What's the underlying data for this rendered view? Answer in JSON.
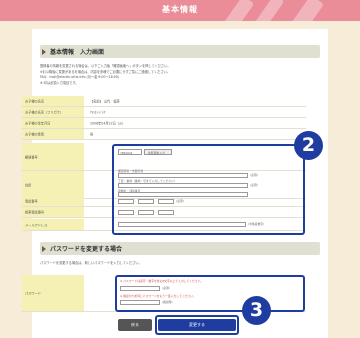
{
  "header": {
    "title": "基本情報"
  },
  "section_basic": {
    "title": "基本情報　入力画面"
  },
  "intro_lines": [
    "登録者の情報を変更される場合は、以下ご入力後「確認画面へ」ボタンを押してください。",
    "※お以降後に変更があるを場合は、内容を多様でご必要にせずご覧にご連絡してください。",
    "FAQ：mail@electtu.bfuk.info (月〜金 9:00〜18:00)",
    "※ 印は必須入力項目です。"
  ],
  "fields": {
    "name_label": "お子様の氏名",
    "name_value": "【名前】 山代　幅茶",
    "kana_label": "お子様の氏名（フリガナ）",
    "kana_value": "ﾔﾏｼﾛ ﾊﾊﾞﾁﾔ",
    "birth_label": "お子様の生年月日",
    "birth_value": "2008年04月22日（火）",
    "gender_label": "お子様の性別",
    "gender_value": "男",
    "zip_label": "郵便番号",
    "zip_value": "7860044",
    "zip_button": "住所自動入力",
    "address_label": "住所",
    "address_hint_1": "都道府県・市区町村",
    "address_hint_2": "丁目・番地（番地・号まで入力してください）",
    "address_hint_3": "建物名・部屋番号",
    "required_mark": "(必須)",
    "phone_label": "電話番号",
    "mobile_label": "携帯電話番号",
    "email_label": "メールアドレス",
    "email_suffix": "(半角英数字)",
    "dash": "-"
  },
  "section_password": {
    "title": "パスワードを変更する場合"
  },
  "password_note": "パスワードを変更する場合は、新しいパスワードを入力してください。",
  "password_field": {
    "label": "パスワード",
    "hint_1": "※ パスワードは英字・数字を含む8文字以上で入力してください。",
    "hint_2": "※ 確認のため同じパスワードをもう一度入力してください。",
    "confirm_hint": "(確認用)"
  },
  "buttons": {
    "back": "戻る",
    "change": "変更する"
  },
  "annotations": {
    "step2": "2",
    "step3": "3"
  },
  "colors": {
    "banner": "#ea8d98",
    "page_bg": "#f6ecd8",
    "label_bg": "#f5f0b4",
    "accent": "#1f3da0",
    "required": "#d24a4a"
  }
}
